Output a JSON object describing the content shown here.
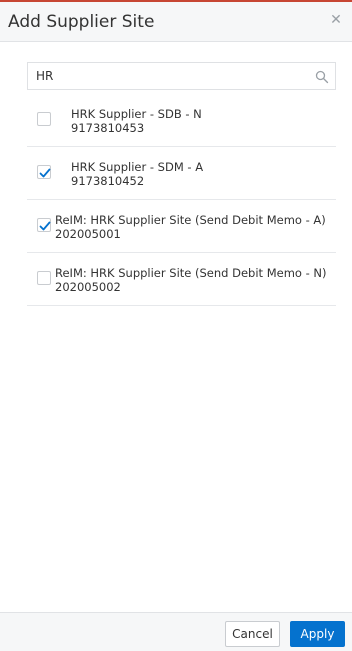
{
  "dialog": {
    "title": "Add Supplier Site",
    "close_icon": "close-icon"
  },
  "search": {
    "value": "HR",
    "icon": "search-icon"
  },
  "results": [
    {
      "name": "HRK Supplier - SDB - N",
      "id": "9173810453",
      "checked": false
    },
    {
      "name": "HRK Supplier - SDM - A",
      "id": "9173810452",
      "checked": true
    },
    {
      "name": "ReIM: HRK Supplier Site (Send Debit Memo - A)",
      "id": "202005001",
      "checked": true
    },
    {
      "name": "ReIM: HRK Supplier Site (Send Debit Memo - N)",
      "id": "202005002",
      "checked": false
    }
  ],
  "footer": {
    "cancel_label": "Cancel",
    "apply_label": "Apply"
  },
  "colors": {
    "accent": "#0572ce",
    "checkmark": "#0572ce",
    "top_border": "#c74634"
  }
}
